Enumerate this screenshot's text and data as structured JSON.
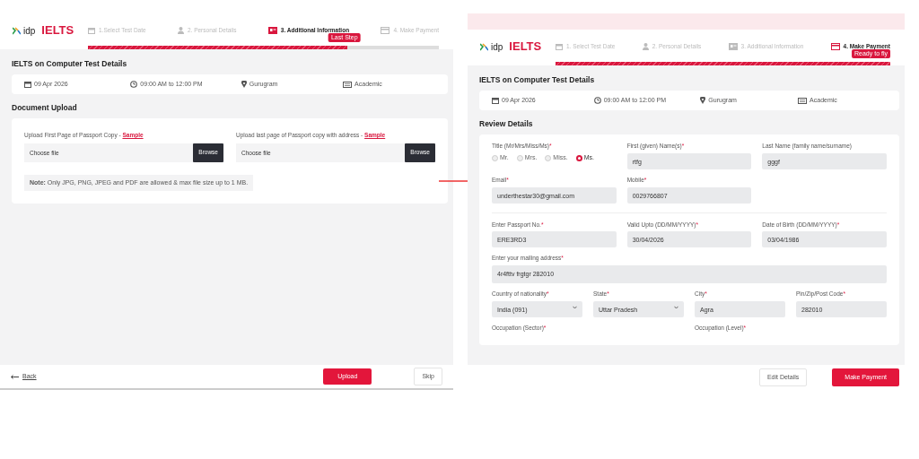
{
  "screens": [
    {
      "alert_strip": false,
      "logo": {
        "brand": "idp",
        "product": "IELTS"
      },
      "steps": [
        {
          "label": "1.Select Test Date",
          "selected": false
        },
        {
          "label": "2. Personal Details",
          "selected": false
        },
        {
          "label": "3. Additional Information",
          "selected": true
        },
        {
          "label": "4. Make Payment",
          "selected": false
        }
      ],
      "progress": {
        "level": 0.74,
        "badge": "Last Step"
      },
      "test_details": {
        "title": "IELTS on Computer Test Details",
        "items": [
          "09 Apr 2026",
          "09:00 AM to 12:00 PM",
          "Gurugram",
          "Academic"
        ]
      },
      "section": {
        "kind": "upload",
        "title": "Document Upload",
        "uploads": [
          {
            "label": "Upload First Page of Passport Copy - ",
            "link": "Sample",
            "value": "Choose file",
            "button": "Browse"
          },
          {
            "label": "Upload last page of Passport copy with address - ",
            "link": "Sample",
            "value": "Choose file",
            "button": "Browse"
          }
        ],
        "note": "**Note:** Only JPG, PNG, JPEG and PDF are allowed & max file size up to 1 MB."
      },
      "footer": {
        "back": "Back",
        "buttons": [
          {
            "label": "Upload",
            "kind": "primary"
          },
          {
            "label": "Skip",
            "kind": "outline"
          }
        ]
      }
    },
    {
      "alert_strip": true,
      "logo": {
        "brand": "idp",
        "product": "IELTS"
      },
      "steps": [
        {
          "label": "1. Select Test Date",
          "selected": false
        },
        {
          "label": "2. Personal Details",
          "selected": false
        },
        {
          "label": "3. Additional Information",
          "selected": false
        },
        {
          "label": "4. Make Payment",
          "selected": true
        }
      ],
      "progress": {
        "level": 1,
        "badge": "Ready to fly"
      },
      "test_details": {
        "title": "IELTS on Computer Test Details",
        "items": [
          "09 Apr 2026",
          "09:00 AM to 12:00 PM",
          "Gurugram",
          "Academic"
        ]
      },
      "section": {
        "kind": "review",
        "title": "Review Details",
        "groups": [
          {
            "rows": [
              {
                "fields": [
                  {
                    "kind": "radio",
                    "label": "Title (Mr/Mrs/Miss/Ms)",
                    "mark": "*",
                    "options": [
                      {
                        "label": "Mr.",
                        "selected": false
                      },
                      {
                        "label": "Mrs.",
                        "selected": false
                      },
                      {
                        "label": "Miss.",
                        "selected": false
                      },
                      {
                        "label": "Ms.",
                        "selected": true
                      }
                    ]
                  },
                  {
                    "kind": "text",
                    "label": "First (given) Name(s)",
                    "mark": "*",
                    "value": "rtfg"
                  },
                  {
                    "kind": "text",
                    "label": "Last Name (family name/surname)",
                    "value": "gggf"
                  }
                ]
              },
              {
                "fields": [
                  {
                    "kind": "text",
                    "label": "Email",
                    "mark": "*",
                    "value": "underthestar30@gmail.com"
                  },
                  {
                    "kind": "text",
                    "label": "Mobile",
                    "mark": "*",
                    "value": "0029766807"
                  }
                ]
              }
            ]
          },
          {
            "rows": [
              {
                "fields": [
                  {
                    "kind": "text",
                    "label": "Enter Passport No.",
                    "mark": "*",
                    "value": "ERE3RD3"
                  },
                  {
                    "kind": "text",
                    "label": "Valid Upto (DD/MM/YYYY)",
                    "mark": "*",
                    "value": "30/04/2026"
                  },
                  {
                    "kind": "text",
                    "label": "Date of Birth (DD/MM/YYYY)",
                    "mark": "*",
                    "value": "03/04/1986"
                  }
                ]
              },
              {
                "fields": [
                  {
                    "kind": "textarea",
                    "label": "Enter your mailing address",
                    "mark": "*",
                    "value": "4r4fttv frgtgr 282010"
                  }
                ]
              },
              {
                "fields": [
                  {
                    "kind": "select",
                    "label": "Country of nationality",
                    "mark": "*",
                    "value": "India (091)"
                  },
                  {
                    "kind": "select",
                    "label": "State",
                    "mark": "*",
                    "value": "Uttar Pradesh"
                  },
                  {
                    "kind": "text",
                    "label": "City",
                    "mark": "*",
                    "value": "Agra"
                  },
                  {
                    "kind": "text",
                    "label": "Pin/Zip/Post Code",
                    "mark": "*",
                    "value": "282010"
                  }
                ]
              },
              {
                "fields": [
                  {
                    "kind": "label",
                    "label": "Occupation (Sector)",
                    "mark": "*"
                  },
                  {
                    "kind": "label",
                    "label": "Occupation (Level)",
                    "mark": "*"
                  }
                ]
              }
            ]
          }
        ]
      },
      "footer": {
        "buttons": [
          {
            "label": "Edit Details",
            "kind": "outline"
          },
          {
            "label": "Make Payment",
            "kind": "primary"
          }
        ]
      }
    }
  ]
}
